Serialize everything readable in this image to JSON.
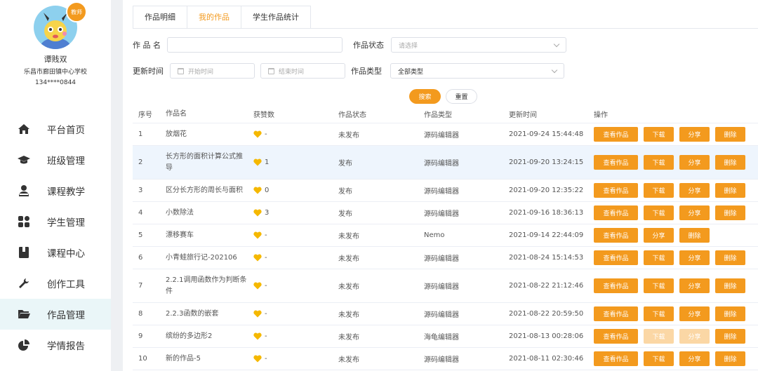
{
  "user": {
    "badge": "教师",
    "name": "谭贱双",
    "school": "乐昌市廊田镇中心学校",
    "phone": "134****0844"
  },
  "nav": [
    {
      "label": "平台首页",
      "icon": "home-icon"
    },
    {
      "label": "班级管理",
      "icon": "graduation-cap-icon"
    },
    {
      "label": "课程教学",
      "icon": "teacher-icon"
    },
    {
      "label": "学生管理",
      "icon": "grid-icon"
    },
    {
      "label": "课程中心",
      "icon": "book-icon"
    },
    {
      "label": "创作工具",
      "icon": "wrench-icon"
    },
    {
      "label": "作品管理",
      "icon": "folder-icon",
      "active": true
    },
    {
      "label": "学情报告",
      "icon": "pie-chart-icon"
    }
  ],
  "tabs": [
    "作品明细",
    "我的作品",
    "学生作品统计"
  ],
  "active_tab": 1,
  "filters": {
    "name_label": "作 品 名",
    "name_value": "",
    "status_label": "作品状态",
    "status_placeholder": "请选择",
    "time_label": "更新时间",
    "start_placeholder": "开始时间",
    "end_placeholder": "结束时间",
    "type_label": "作品类型",
    "type_value": "全部类型"
  },
  "buttons": {
    "search": "搜索",
    "reset": "重置"
  },
  "table": {
    "headers": [
      "序号",
      "作品名",
      "获赞数",
      "作品状态",
      "作品类型",
      "更新时间",
      "操作"
    ],
    "ops": {
      "view": "查看作品",
      "download": "下载",
      "share": "分享",
      "delete": "删除"
    },
    "rows": [
      {
        "no": "1",
        "name": "放烟花",
        "likes": "-",
        "status": "未发布",
        "type": "源码编辑器",
        "time": "2021-09-24 15:44:48",
        "ops": [
          "view",
          "download",
          "share",
          "delete"
        ]
      },
      {
        "no": "2",
        "name": "长方形的面积计算公式推导",
        "likes": "1",
        "status": "发布",
        "type": "源码编辑器",
        "time": "2021-09-20 13:24:15",
        "ops": [
          "view",
          "download",
          "share",
          "delete"
        ],
        "highlight": true,
        "tall": true
      },
      {
        "no": "3",
        "name": "区分长方形的周长与面积",
        "likes": "0",
        "status": "发布",
        "type": "源码编辑器",
        "time": "2021-09-20 12:35:22",
        "ops": [
          "view",
          "download",
          "share",
          "delete"
        ]
      },
      {
        "no": "4",
        "name": "小数除法",
        "likes": "3",
        "status": "发布",
        "type": "源码编辑器",
        "time": "2021-09-16 18:36:13",
        "ops": [
          "view",
          "download",
          "share",
          "delete"
        ]
      },
      {
        "no": "5",
        "name": "漂移赛车",
        "likes": "-",
        "status": "未发布",
        "type": "Nemo",
        "time": "2021-09-14 22:44:09",
        "ops": [
          "view",
          "share",
          "delete"
        ]
      },
      {
        "no": "6",
        "name": "小青蛙旅行记-202106",
        "likes": "-",
        "status": "未发布",
        "type": "源码编辑器",
        "time": "2021-08-24 15:14:53",
        "ops": [
          "view",
          "download",
          "share",
          "delete"
        ]
      },
      {
        "no": "7",
        "name": "2.2.1调用函数作为判断条件",
        "likes": "-",
        "status": "未发布",
        "type": "源码编辑器",
        "time": "2021-08-22 21:12:46",
        "ops": [
          "view",
          "download",
          "share",
          "delete"
        ],
        "tall": true
      },
      {
        "no": "8",
        "name": "2.2.3函数的嵌套",
        "likes": "-",
        "status": "未发布",
        "type": "源码编辑器",
        "time": "2021-08-22 20:59:50",
        "ops": [
          "view",
          "download",
          "share",
          "delete"
        ]
      },
      {
        "no": "9",
        "name": "缤纷的多边形2",
        "likes": "-",
        "status": "未发布",
        "type": "海龟编辑器",
        "time": "2021-08-13 00:28:06",
        "ops": [
          "view",
          "download",
          "share",
          "delete"
        ],
        "dim_ops": [
          "download",
          "share"
        ]
      },
      {
        "no": "10",
        "name": "新的作品-5",
        "likes": "-",
        "status": "未发布",
        "type": "源码编辑器",
        "time": "2021-08-11 02:30:46",
        "ops": [
          "view",
          "download",
          "share",
          "delete"
        ]
      }
    ]
  },
  "colors": {
    "accent": "#f39a1e",
    "heart": "#f5b800",
    "active_nav_bg": "#eaf6f8"
  }
}
